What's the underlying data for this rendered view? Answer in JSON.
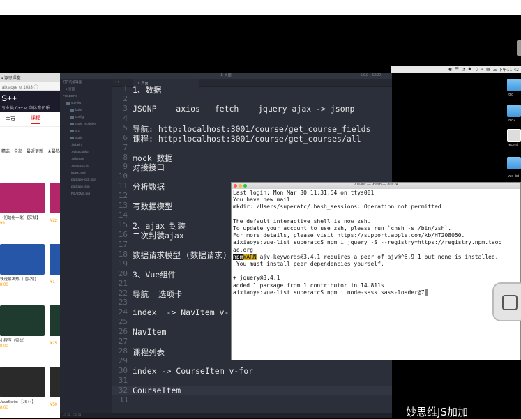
{
  "menubar": {
    "items": [
      "◐",
      "☰",
      "◔",
      "✱",
      "♫",
      "⌁",
      "▤",
      "三 下午11:42"
    ]
  },
  "browser": {
    "tab_label": "▪ 源思课堂",
    "address": "aixiaoye ⊙ 1033 ⓘ",
    "header_big": "S++",
    "header_small": "专业类 C++ ⊘  华体育亿乐…",
    "tabs": [
      "主页",
      "课程"
    ],
    "filters": [
      "精选",
      "全部",
      "最近更新",
      "★最热门"
    ],
    "cards": [
      {
        "meta": "（初始化一致）【实战】",
        "price": "99",
        "color": "#b3266a"
      },
      {
        "meta": "快速解决热门【实战】",
        "price": "8.00",
        "color": "#2556a8"
      },
      {
        "meta": "小程序（实战）",
        "price": "8.00",
        "color": "#1f3a2f"
      },
      {
        "meta": "JavaScript 【JS++】",
        "price": "8.00",
        "color": "#2a2a2a"
      }
    ],
    "side_prices": [
      "¥22",
      "¥1",
      "¥25",
      "¥50"
    ]
  },
  "editor": {
    "window_title": "1. 页面",
    "window_right": "1.0.0 + 12:00",
    "tab_label": "1. 页面",
    "statusbar": "Ln 32, Col 11",
    "sidebar": [
      {
        "label": "打开的编辑器",
        "kind": "header"
      },
      {
        "label": "● 页面",
        "kind": "file"
      },
      {
        "label": "FOLDERS",
        "kind": "header"
      },
      {
        "label": "vue-list",
        "kind": "folder"
      },
      {
        "label": "build",
        "kind": "folder"
      },
      {
        "label": "config",
        "kind": "folder"
      },
      {
        "label": "node_modules",
        "kind": "folder"
      },
      {
        "label": "src",
        "kind": "folder"
      },
      {
        "label": "static",
        "kind": "folder"
      },
      {
        "label": ".babelrc",
        "kind": "file"
      },
      {
        "label": ".editorconfig",
        "kind": "file"
      },
      {
        "label": ".gitignore",
        "kind": "file"
      },
      {
        "label": ".postcssrc.js",
        "kind": "file"
      },
      {
        "label": "index.html",
        "kind": "file"
      },
      {
        "label": "package-lock.json",
        "kind": "file"
      },
      {
        "label": "package.json",
        "kind": "file"
      },
      {
        "label": "README.md",
        "kind": "file"
      }
    ],
    "lines": [
      {
        "n": "1",
        "t": "1、数据"
      },
      {
        "n": "2",
        "t": ""
      },
      {
        "n": "3",
        "t": "JSONP    axios   fetch    jquery ajax -> jsonp"
      },
      {
        "n": "4",
        "t": ""
      },
      {
        "n": "5",
        "t": "导航: http:localhost:3001/course/get_course_fields"
      },
      {
        "n": "6",
        "t": "课程: http:localhost:3001/course/get_courses/all"
      },
      {
        "n": "7",
        "t": ""
      },
      {
        "n": "8",
        "t": "mock 数据"
      },
      {
        "n": "9",
        "t": "对接接口"
      },
      {
        "n": "10",
        "t": ""
      },
      {
        "n": "11",
        "t": "分析数据"
      },
      {
        "n": "12",
        "t": ""
      },
      {
        "n": "13",
        "t": "写数据模型"
      },
      {
        "n": "14",
        "t": ""
      },
      {
        "n": "15",
        "t": "2、ajax 封装"
      },
      {
        "n": "16",
        "t": "二次封装ajax"
      },
      {
        "n": "17",
        "t": ""
      },
      {
        "n": "18",
        "t": "数据请求模型 (数据请求)"
      },
      {
        "n": "19",
        "t": ""
      },
      {
        "n": "20",
        "t": "3、Vue组件"
      },
      {
        "n": "21",
        "t": ""
      },
      {
        "n": "22",
        "t": "导航  选项卡"
      },
      {
        "n": "23",
        "t": ""
      },
      {
        "n": "24",
        "t": "index  -> NavItem v-"
      },
      {
        "n": "25",
        "t": ""
      },
      {
        "n": "26",
        "t": "NavItem"
      },
      {
        "n": "27",
        "t": ""
      },
      {
        "n": "28",
        "t": "课程列表"
      },
      {
        "n": "29",
        "t": ""
      },
      {
        "n": "30",
        "t": "index -> CourseItem v-for"
      },
      {
        "n": "31",
        "t": ""
      },
      {
        "n": "32",
        "t": "CourseItem"
      },
      {
        "n": "33",
        "t": ""
      }
    ]
  },
  "terminal": {
    "title": "vue-list — -bash — 80×24",
    "lines": [
      "Last login: Mon Mar 30 11:31:54 on ttys001",
      "You have new mail.",
      "mkdir: /Users/superatc/.bash_sessions: Operation not permitted",
      "",
      "The default interactive shell is now zsh.",
      "To update your account to use zsh, please run `chsh -s /bin/zsh`.",
      "For more details, please visit https://support.apple.com/kb/HT208050.",
      "aixiaoye:vue-list superatcS npm i jquery -S --registry=https://registry.npm.taob",
      "ao.org"
    ],
    "warn_npm": "npm",
    "warn_tag": "WARN",
    "warn_rest": " ajv-keywords@3.4.1 requires a peer of ajv@^6.9.1 but none is installed.",
    "lines_after": [
      " You must install peer dependencies yourself.",
      "",
      "+ jquery@3.4.1",
      "added 1 package from 1 contributor in 14.811s",
      "aixiaoye:vue-list superatcS npm i node-sass sass-loader@7"
    ]
  },
  "desktop": {
    "icons": [
      "fold",
      "fold2",
      "recent",
      "vue-list",
      "vue-"
    ],
    "watermark": "妙思维JS加加"
  }
}
